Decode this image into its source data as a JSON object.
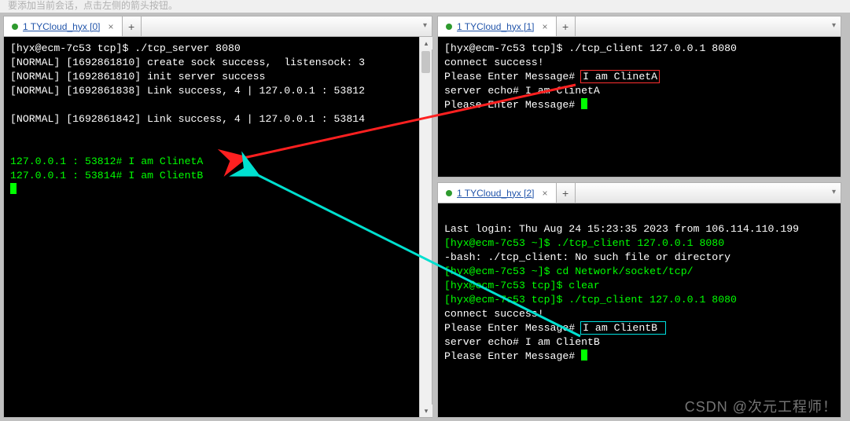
{
  "top_hint": "要添加当前会话，点击左侧的箭头按钮。",
  "tabs": {
    "left": {
      "title": "1 TYCloud_hyx [0]"
    },
    "tr": {
      "title": "1 TYCloud_hyx [1]"
    },
    "br": {
      "title": "1 TYCloud_hyx [2]"
    }
  },
  "add_glyph": "+",
  "close_glyph": "×",
  "dd_glyph": "▾",
  "sb_up": "▴",
  "sb_down": "▾",
  "watermark": "CSDN @次元工程师！",
  "term_left": {
    "l1": "[hyx@ecm-7c53 tcp]$ ./tcp_server 8080",
    "l2": "[NORMAL] [1692861810] create sock success,  listensock: 3",
    "l3": "[NORMAL] [1692861810] init server success",
    "l4": "[NORMAL] [1692861838] Link success, 4 | 127.0.0.1 : 53812",
    "l5": "",
    "l6": "[NORMAL] [1692861842] Link success, 4 | 127.0.0.1 : 53814",
    "l7": "",
    "l8": "",
    "l9": "127.0.0.1 : 53812# I am ClinetA",
    "l10": "127.0.0.1 : 53814# I am ClientB"
  },
  "term_tr": {
    "l1": "[hyx@ecm-7c53 tcp]$ ./tcp_client 127.0.0.1 8080",
    "l2": "connect success!",
    "l3a": "Please Enter Message# ",
    "l3b": "I am ClinetA",
    "l4": "server echo# I am ClinetA",
    "l5": "Please Enter Message# "
  },
  "term_br": {
    "l0": "",
    "l1": "Last login: Thu Aug 24 15:23:35 2023 from 106.114.110.199",
    "l2": "[hyx@ecm-7c53 ~]$ ./tcp_client 127.0.0.1 8080",
    "l3": "-bash: ./tcp_client: No such file or directory",
    "l4": "[hyx@ecm-7c53 ~]$ cd Network/socket/tcp/",
    "l5": "[hyx@ecm-7c53 tcp]$ clear",
    "l6": "[hyx@ecm-7c53 tcp]$ ./tcp_client 127.0.0.1 8080",
    "l7": "connect success!",
    "l8a": "Please Enter Message# ",
    "l8b": "I am ClientB ",
    "l9": "server echo# I am ClientB",
    "l10": "Please Enter Message# "
  },
  "colors": {
    "arrow_red": "#ff2020",
    "arrow_cyan": "#00e0d0"
  }
}
